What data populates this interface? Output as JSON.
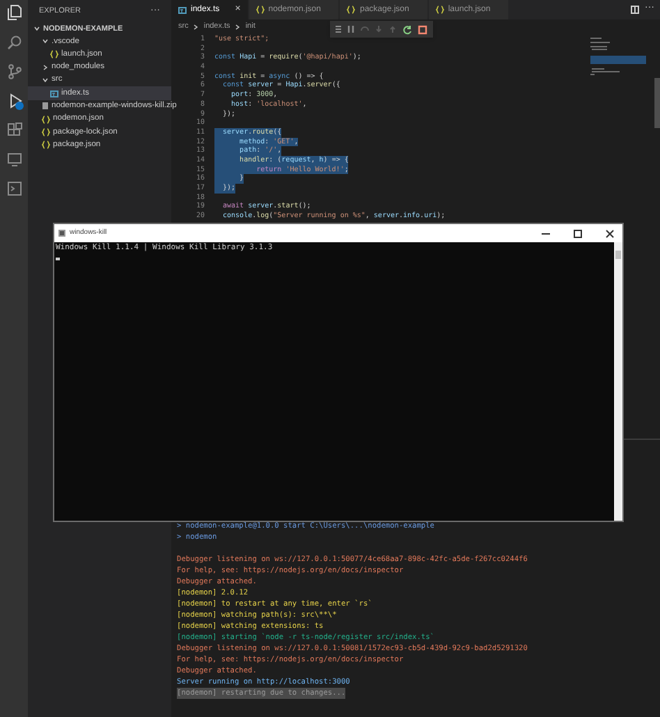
{
  "sidebar": {
    "title": "EXPLORER",
    "more": "···",
    "items": [
      {
        "label": "NODEMON-EXAMPLE",
        "kind": "root",
        "expanded": true,
        "selected": false,
        "children": [
          {
            "label": ".vscode",
            "kind": "folder",
            "expanded": true,
            "selected": false,
            "children": [
              {
                "label": "launch.json",
                "kind": "json",
                "selected": false
              }
            ]
          },
          {
            "label": "node_modules",
            "kind": "folder",
            "expanded": false,
            "selected": false
          },
          {
            "label": "src",
            "kind": "folder",
            "expanded": true,
            "selected": false,
            "children": [
              {
                "label": "index.ts",
                "kind": "ts",
                "selected": true
              }
            ]
          },
          {
            "label": "nodemon-example-windows-kill.zip",
            "kind": "zip",
            "selected": false
          },
          {
            "label": "nodemon.json",
            "kind": "json",
            "selected": false
          },
          {
            "label": "package-lock.json",
            "kind": "json",
            "selected": false
          },
          {
            "label": "package.json",
            "kind": "json",
            "selected": false
          }
        ]
      }
    ]
  },
  "tabs": [
    {
      "label": "index.ts",
      "kind": "ts",
      "selected": true,
      "close": "×"
    },
    {
      "label": "nodemon.json",
      "kind": "json",
      "selected": false
    },
    {
      "label": "package.json",
      "kind": "json",
      "selected": false
    },
    {
      "label": "launch.json",
      "kind": "json",
      "selected": false
    }
  ],
  "editor_more": "···",
  "breadcrumb": [
    "src",
    "index.ts",
    "init"
  ],
  "code": [
    {
      "n": "1",
      "selected": false,
      "tokens": [
        {
          "text": "\"use strict\";",
          "kind": "str"
        }
      ]
    },
    {
      "n": "2"
    },
    {
      "n": "3",
      "selected": false,
      "tokens": [
        {
          "text": "const ",
          "kind": "kw"
        },
        {
          "text": "Hapi",
          "kind": "var"
        },
        {
          "text": " = ",
          "kind": "p"
        },
        {
          "text": "require",
          "kind": "fn"
        },
        {
          "text": "(",
          "kind": "p"
        },
        {
          "text": "'@hapi/hapi'",
          "kind": "str"
        },
        {
          "text": ");",
          "kind": "p"
        }
      ]
    },
    {
      "n": "4"
    },
    {
      "n": "5",
      "selected": false,
      "tokens": [
        {
          "text": "const ",
          "kind": "kw"
        },
        {
          "text": "init",
          "kind": "fn"
        },
        {
          "text": " = ",
          "kind": "p"
        },
        {
          "text": "async",
          "kind": "kw"
        },
        {
          "text": " () => {",
          "kind": "p"
        }
      ]
    },
    {
      "n": "6",
      "selected": false,
      "tokens": [
        {
          "text": "  const ",
          "kind": "kw"
        },
        {
          "text": "server",
          "kind": "var"
        },
        {
          "text": " = ",
          "kind": "p"
        },
        {
          "text": "Hapi",
          "kind": "var"
        },
        {
          "text": ".",
          "kind": "p"
        },
        {
          "text": "server",
          "kind": "fn"
        },
        {
          "text": "({",
          "kind": "p"
        }
      ]
    },
    {
      "n": "7",
      "selected": false,
      "tokens": [
        {
          "text": "    port",
          "kind": "var"
        },
        {
          "text": ": ",
          "kind": "p"
        },
        {
          "text": "3000",
          "kind": "num"
        },
        {
          "text": ",",
          "kind": "p"
        }
      ]
    },
    {
      "n": "8",
      "selected": false,
      "tokens": [
        {
          "text": "    host",
          "kind": "var"
        },
        {
          "text": ": ",
          "kind": "p"
        },
        {
          "text": "'localhost'",
          "kind": "str"
        },
        {
          "text": ",",
          "kind": "p"
        }
      ]
    },
    {
      "n": "9",
      "selected": false,
      "tokens": [
        {
          "text": "  });",
          "kind": "p"
        }
      ]
    },
    {
      "n": "10"
    },
    {
      "n": "11",
      "selected": true,
      "tokens": [
        {
          "text": "  server",
          "kind": "var"
        },
        {
          "text": ".",
          "kind": "p"
        },
        {
          "text": "route",
          "kind": "fn"
        },
        {
          "text": "({",
          "kind": "p"
        }
      ]
    },
    {
      "n": "12",
      "selected": true,
      "tokens": [
        {
          "text": "      method",
          "kind": "var"
        },
        {
          "text": ": ",
          "kind": "p"
        },
        {
          "text": "'GET'",
          "kind": "str"
        },
        {
          "text": ",",
          "kind": "p"
        }
      ]
    },
    {
      "n": "13",
      "selected": true,
      "tokens": [
        {
          "text": "      path",
          "kind": "var"
        },
        {
          "text": ": ",
          "kind": "p"
        },
        {
          "text": "'/'",
          "kind": "str"
        },
        {
          "text": ",",
          "kind": "p"
        }
      ]
    },
    {
      "n": "14",
      "selected": true,
      "tokens": [
        {
          "text": "      handler",
          "kind": "fn"
        },
        {
          "text": ": (",
          "kind": "p"
        },
        {
          "text": "request",
          "kind": "var"
        },
        {
          "text": ", ",
          "kind": "p"
        },
        {
          "text": "h",
          "kind": "var"
        },
        {
          "text": ") => {",
          "kind": "p"
        }
      ]
    },
    {
      "n": "15",
      "selected": true,
      "tokens": [
        {
          "text": "          return ",
          "kind": "ctl"
        },
        {
          "text": "'Hello World!'",
          "kind": "str"
        },
        {
          "text": ";",
          "kind": "p"
        }
      ]
    },
    {
      "n": "16",
      "selected": true,
      "tokens": [
        {
          "text": "      }",
          "kind": "p"
        }
      ]
    },
    {
      "n": "17",
      "selected": true,
      "tokens": [
        {
          "text": "  });",
          "kind": "p"
        }
      ]
    },
    {
      "n": "18"
    },
    {
      "n": "19",
      "selected": false,
      "tokens": [
        {
          "text": "  await ",
          "kind": "ctl"
        },
        {
          "text": "server",
          "kind": "var"
        },
        {
          "text": ".",
          "kind": "p"
        },
        {
          "text": "start",
          "kind": "fn"
        },
        {
          "text": "();",
          "kind": "p"
        }
      ]
    },
    {
      "n": "20",
      "selected": false,
      "tokens": [
        {
          "text": "  console",
          "kind": "var"
        },
        {
          "text": ".",
          "kind": "p"
        },
        {
          "text": "log",
          "kind": "fn"
        },
        {
          "text": "(",
          "kind": "p"
        },
        {
          "text": "\"Server running on %s\"",
          "kind": "str"
        },
        {
          "text": ", ",
          "kind": "p"
        },
        {
          "text": "server",
          "kind": "var"
        },
        {
          "text": ".",
          "kind": "p"
        },
        {
          "text": "info",
          "kind": "var"
        },
        {
          "text": ".",
          "kind": "p"
        },
        {
          "text": "uri",
          "kind": "var"
        },
        {
          "text": ");",
          "kind": "p"
        }
      ]
    }
  ],
  "terminal": [
    {
      "text": "> nodemon-example@1.0.0 start C:\\Users\\...\\nodemon-example",
      "kind": "prompt"
    },
    {
      "text": "> nodemon",
      "kind": "prompt"
    },
    {
      "text": "Debugger listening on ws://127.0.0.1:50077/4ce68aa7-898c-42fc-a5de-f267cc0244f6",
      "kind": "debug",
      "spaced": true
    },
    {
      "text": "For help, see: https://nodejs.org/en/docs/inspector",
      "kind": "debug"
    },
    {
      "text": "Debugger attached.",
      "kind": "debug"
    },
    {
      "text": "[nodemon] 2.0.12",
      "kind": "nodemon"
    },
    {
      "text": "[nodemon] to restart at any time, enter `rs`",
      "kind": "nodemon"
    },
    {
      "text": "[nodemon] watching path(s): src\\**\\*",
      "kind": "nodemon"
    },
    {
      "text": "[nodemon] watching extensions: ts",
      "kind": "nodemon"
    },
    {
      "text": "[nodemon] starting `node -r ts-node/register src/index.ts`",
      "kind": "starting"
    },
    {
      "text": "Debugger listening on ws://127.0.0.1:50081/1572ec93-cb5d-439d-92c9-bad2d5291320",
      "kind": "debug"
    },
    {
      "text": "For help, see: https://nodejs.org/en/docs/inspector",
      "kind": "debug"
    },
    {
      "text": "Debugger attached.",
      "kind": "debug"
    },
    {
      "text": "Server running on http://localhost:3000",
      "kind": "server"
    },
    {
      "text": "[nodemon] restarting due to changes...",
      "kind": "status"
    }
  ],
  "console_window": {
    "title": "windows-kill",
    "output": "Windows Kill 1.1.4 | Windows Kill Library 3.1.3"
  }
}
